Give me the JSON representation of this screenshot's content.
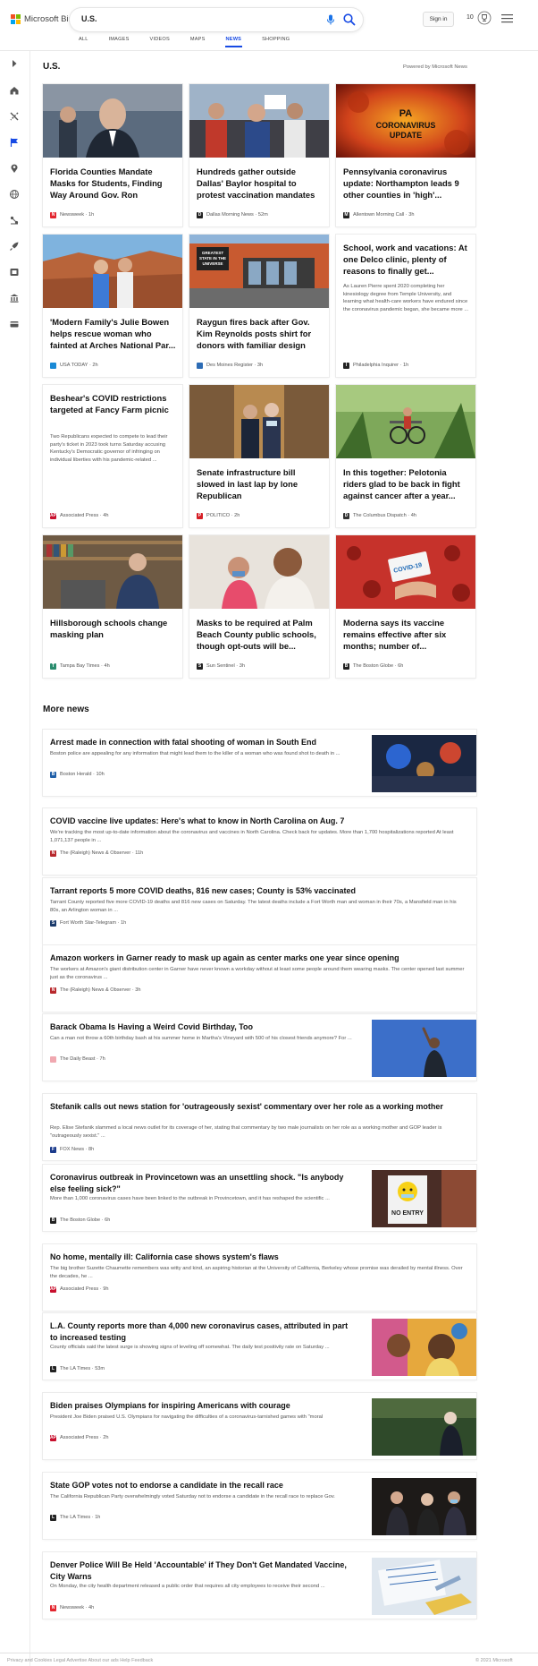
{
  "header": {
    "logo_text": "Microsoft Bing",
    "search_query": "U.S.",
    "signin_label": "Sign in",
    "reward_points": "10",
    "tabs": [
      {
        "label": "ALL"
      },
      {
        "label": "IMAGES"
      },
      {
        "label": "VIDEOS"
      },
      {
        "label": "MAPS"
      },
      {
        "label": "NEWS",
        "active": true
      },
      {
        "label": "SHOPPING"
      }
    ]
  },
  "sidebar": {
    "icons": [
      "expand-arrow-icon",
      "home-icon",
      "crossed-tools-icon",
      "flag-icon",
      "location-pin-icon",
      "globe-icon",
      "science-icon",
      "rocket-icon",
      "film-icon",
      "bank-icon",
      "card-icon"
    ]
  },
  "section": {
    "title": "U.S.",
    "powered_by": "Powered by Microsoft News"
  },
  "cards": [
    {
      "title": "Florida Counties Mandate Masks for Students, Finding Way Around Gov. Ron DeSanti...",
      "source": "Newsweek",
      "time": "1h",
      "has_image": true,
      "logo_color": "#e3262f",
      "logo_char": "N"
    },
    {
      "title": "Hundreds gather outside Dallas' Baylor hospital to protest vaccination mandates",
      "source": "Dallas Morning News",
      "time": "52m",
      "has_image": true,
      "logo_color": "#222222",
      "logo_char": "D"
    },
    {
      "title": "Pennsylvania coronavirus update: Northampton leads 9 other counties in 'high'...",
      "source": "Allentown Morning Call",
      "time": "3h",
      "has_image": true,
      "logo_color": "#222222",
      "logo_char": "M",
      "image_text": "PA CORONAVIRUS UPDATE"
    },
    {
      "title": "'Modern Family's Julie Bowen helps rescue woman who fainted at Arches National Par...",
      "source": "USA TODAY",
      "time": "2h",
      "has_image": true,
      "logo_color": "#1a8ad6",
      "logo_char": ""
    },
    {
      "title": "Raygun fires back after Gov. Kim Reynolds posts shirt for donors with familiar design",
      "source": "Des Moines Register",
      "time": "3h",
      "has_image": true,
      "logo_color": "#2d6cb5",
      "logo_char": "",
      "image_text": "GREATEST STATE IN THE UNIVERSE"
    },
    {
      "title": "School, work and vacations: At one Delco clinic, plenty of reasons to finally get...",
      "snippet": "As Lauren Pierre spent 2020 completing her kinesiology degree from Temple University, and learning what health-care workers have endured since the coronavirus pandemic began, she became more ...",
      "source": "Philadelphia Inquirer",
      "time": "1h",
      "has_image": false,
      "logo_color": "#222222",
      "logo_char": "I"
    },
    {
      "title": "Beshear's COVID restrictions targeted at Fancy Farm picnic",
      "snippet": "Two Republicans expected to compete to lead their party's ticket in 2023 took turns Saturday accusing Kentucky's Democratic governor of infringing on individual liberties with his pandemic-related ...",
      "source": "Associated Press",
      "time": "4h",
      "has_image": false,
      "logo_color": "#c8102e",
      "logo_char": "AP"
    },
    {
      "title": "Senate infrastructure bill slowed in last lap by lone Republican",
      "source": "POLITICO",
      "time": "2h",
      "has_image": true,
      "logo_color": "#d61f26",
      "logo_char": "P"
    },
    {
      "title": "In this together: Pelotonia riders glad to be back in fight against cancer after a year...",
      "source": "The Columbus Dispatch",
      "time": "4h",
      "has_image": true,
      "logo_color": "#333333",
      "logo_char": "D"
    },
    {
      "title": "Hillsborough schools change masking plan",
      "source": "Tampa Bay Times",
      "time": "4h",
      "has_image": true,
      "logo_color": "#2a8c6e",
      "logo_char": "T"
    },
    {
      "title": "Masks to be required at Palm Beach County public schools, though opt-outs will be...",
      "source": "Sun Sentinel",
      "time": "3h",
      "has_image": true,
      "logo_color": "#222222",
      "logo_char": "S"
    },
    {
      "title": "Moderna says its vaccine remains effective after six months; number of...",
      "source": "The Boston Globe",
      "time": "6h",
      "has_image": true,
      "logo_color": "#222222",
      "logo_char": "B",
      "image_text": "COVID-19"
    }
  ],
  "more_news": {
    "title": "More news",
    "items": [
      {
        "title": "Arrest made in connection with fatal shooting of woman in South End",
        "snippet": "Boston police are appealing for any information that might lead them to the killer of a woman who was found shot to death in ...",
        "source": "Boston Herald",
        "time": "10h",
        "has_image": true,
        "logo_color": "#1f5fa8",
        "logo_char": "B"
      },
      {
        "title": "COVID vaccine live updates: Here's what to know in North Carolina on Aug. 7",
        "snippet": "We're tracking the most up-to-date information about the coronavirus and vaccines in North Carolina. Check back for updates. More than 1,700 hospitalizations reported At least 1,071,137 people in ...",
        "source": "The (Raleigh) News & Observer",
        "time": "11h",
        "has_image": false,
        "logo_color": "#b8282c",
        "logo_char": "N"
      },
      {
        "title": "Tarrant reports 5 more COVID deaths, 816 new cases; County is 53% vaccinated",
        "snippet": "Tarrant County reported five more COVID-19 deaths and 816 new cases on Saturday. The latest deaths include a Fort Worth man and woman in their 70s, a Mansfield man in his 80s, an Arlington woman in ...",
        "source": "Fort Worth Star-Telegram",
        "time": "1h",
        "has_image": false,
        "logo_color": "#1a3a6b",
        "logo_char": "S"
      },
      {
        "title": "Amazon workers in Garner ready to mask up again as center marks one year since opening",
        "snippet": "The workers at Amazon's giant distribution center in Garner have never known a workday without at least some people around them wearing masks. The center opened last summer just as the coronavirus ...",
        "source": "The (Raleigh) News & Observer",
        "time": "3h",
        "has_image": false,
        "logo_color": "#b8282c",
        "logo_char": "N"
      },
      {
        "title": "Barack Obama Is Having a Weird Covid Birthday, Too",
        "snippet": "Can a man not throw a 60th birthday bash at his summer home in Martha's Vineyard with 500 of his closest friends anymore? For ...",
        "source": "The Daily Beast",
        "time": "7h",
        "has_image": true,
        "logo_color": "#f0a8b0",
        "logo_char": ""
      },
      {
        "title": "Stefanik calls out news station for 'outrageously sexist' commentary over her role as a working mother",
        "snippet": "Rep. Elise Stefanik slammed a local news outlet for its coverage of her, stating that commentary by two male journalists on her role as a working mother and GOP leader is \"outrageously sexist.\" ...",
        "source": "FOX News",
        "time": "8h",
        "has_image": false,
        "logo_color": "#1b3b8c",
        "logo_char": "F"
      },
      {
        "title": "Coronavirus outbreak in Provincetown was an unsettling shock. \"Is anybody else feeling sick?\"",
        "snippet": "More than 1,000 coronavirus cases have been linked to the outbreak in Provincetown, and it has reshaped the scientific ...",
        "source": "The Boston Globe",
        "time": "6h",
        "has_image": true,
        "logo_color": "#222222",
        "logo_char": "B",
        "image_text": "NO ENTRY"
      },
      {
        "title": "No home, mentally ill: California case shows system's flaws",
        "snippet": "The big brother Suzette Chaumette remembers was witty and kind, an aspiring historian at the University of California, Berkeley whose promise was derailed by mental illness. Over the decades, he ...",
        "source": "Associated Press",
        "time": "9h",
        "has_image": false,
        "logo_color": "#c8102e",
        "logo_char": "AP"
      },
      {
        "title": "L.A. County reports more than 4,000 new coronavirus cases, attributed in part to increased testing",
        "snippet": "County officials said the latest surge is showing signs of leveling off somewhat. The daily test positivity rate on Saturday ...",
        "source": "The LA Times",
        "time": "53m",
        "has_image": true,
        "logo_color": "#222222",
        "logo_char": "L"
      },
      {
        "title": "Biden praises Olympians for inspiring Americans with courage",
        "snippet": "President Joe Biden praised U.S. Olympians for navigating the difficulties of a coronavirus-tarnished games with \"moral",
        "source": "Associated Press",
        "time": "2h",
        "has_image": true,
        "logo_color": "#c8102e",
        "logo_char": "AP"
      },
      {
        "title": "State GOP votes not to endorse a candidate in the recall race",
        "snippet": "The California Republican Party overwhelmingly voted Saturday not to endorse a candidate in the recall race to replace Gov.",
        "source": "The LA Times",
        "time": "1h",
        "has_image": true,
        "logo_color": "#222222",
        "logo_char": "L"
      },
      {
        "title": "Denver Police Will Be Held 'Accountable' if They Don't Get Mandated Vaccine, City Warns",
        "snippet": "On Monday, the city health department released a public order that requires all city employees to receive their second ...",
        "source": "Newsweek",
        "time": "4h",
        "has_image": true,
        "logo_color": "#e3262f",
        "logo_char": "N"
      }
    ]
  },
  "footer": {
    "text": "Privacy and Cookies    Legal    Advertise    About our ads    Help    Feedback",
    "right": "© 2021 Microsoft"
  },
  "colors": {
    "accent": "#174ae4",
    "bing_logo": [
      "#f25022",
      "#7fba00",
      "#00a4ef",
      "#ffb900"
    ]
  }
}
